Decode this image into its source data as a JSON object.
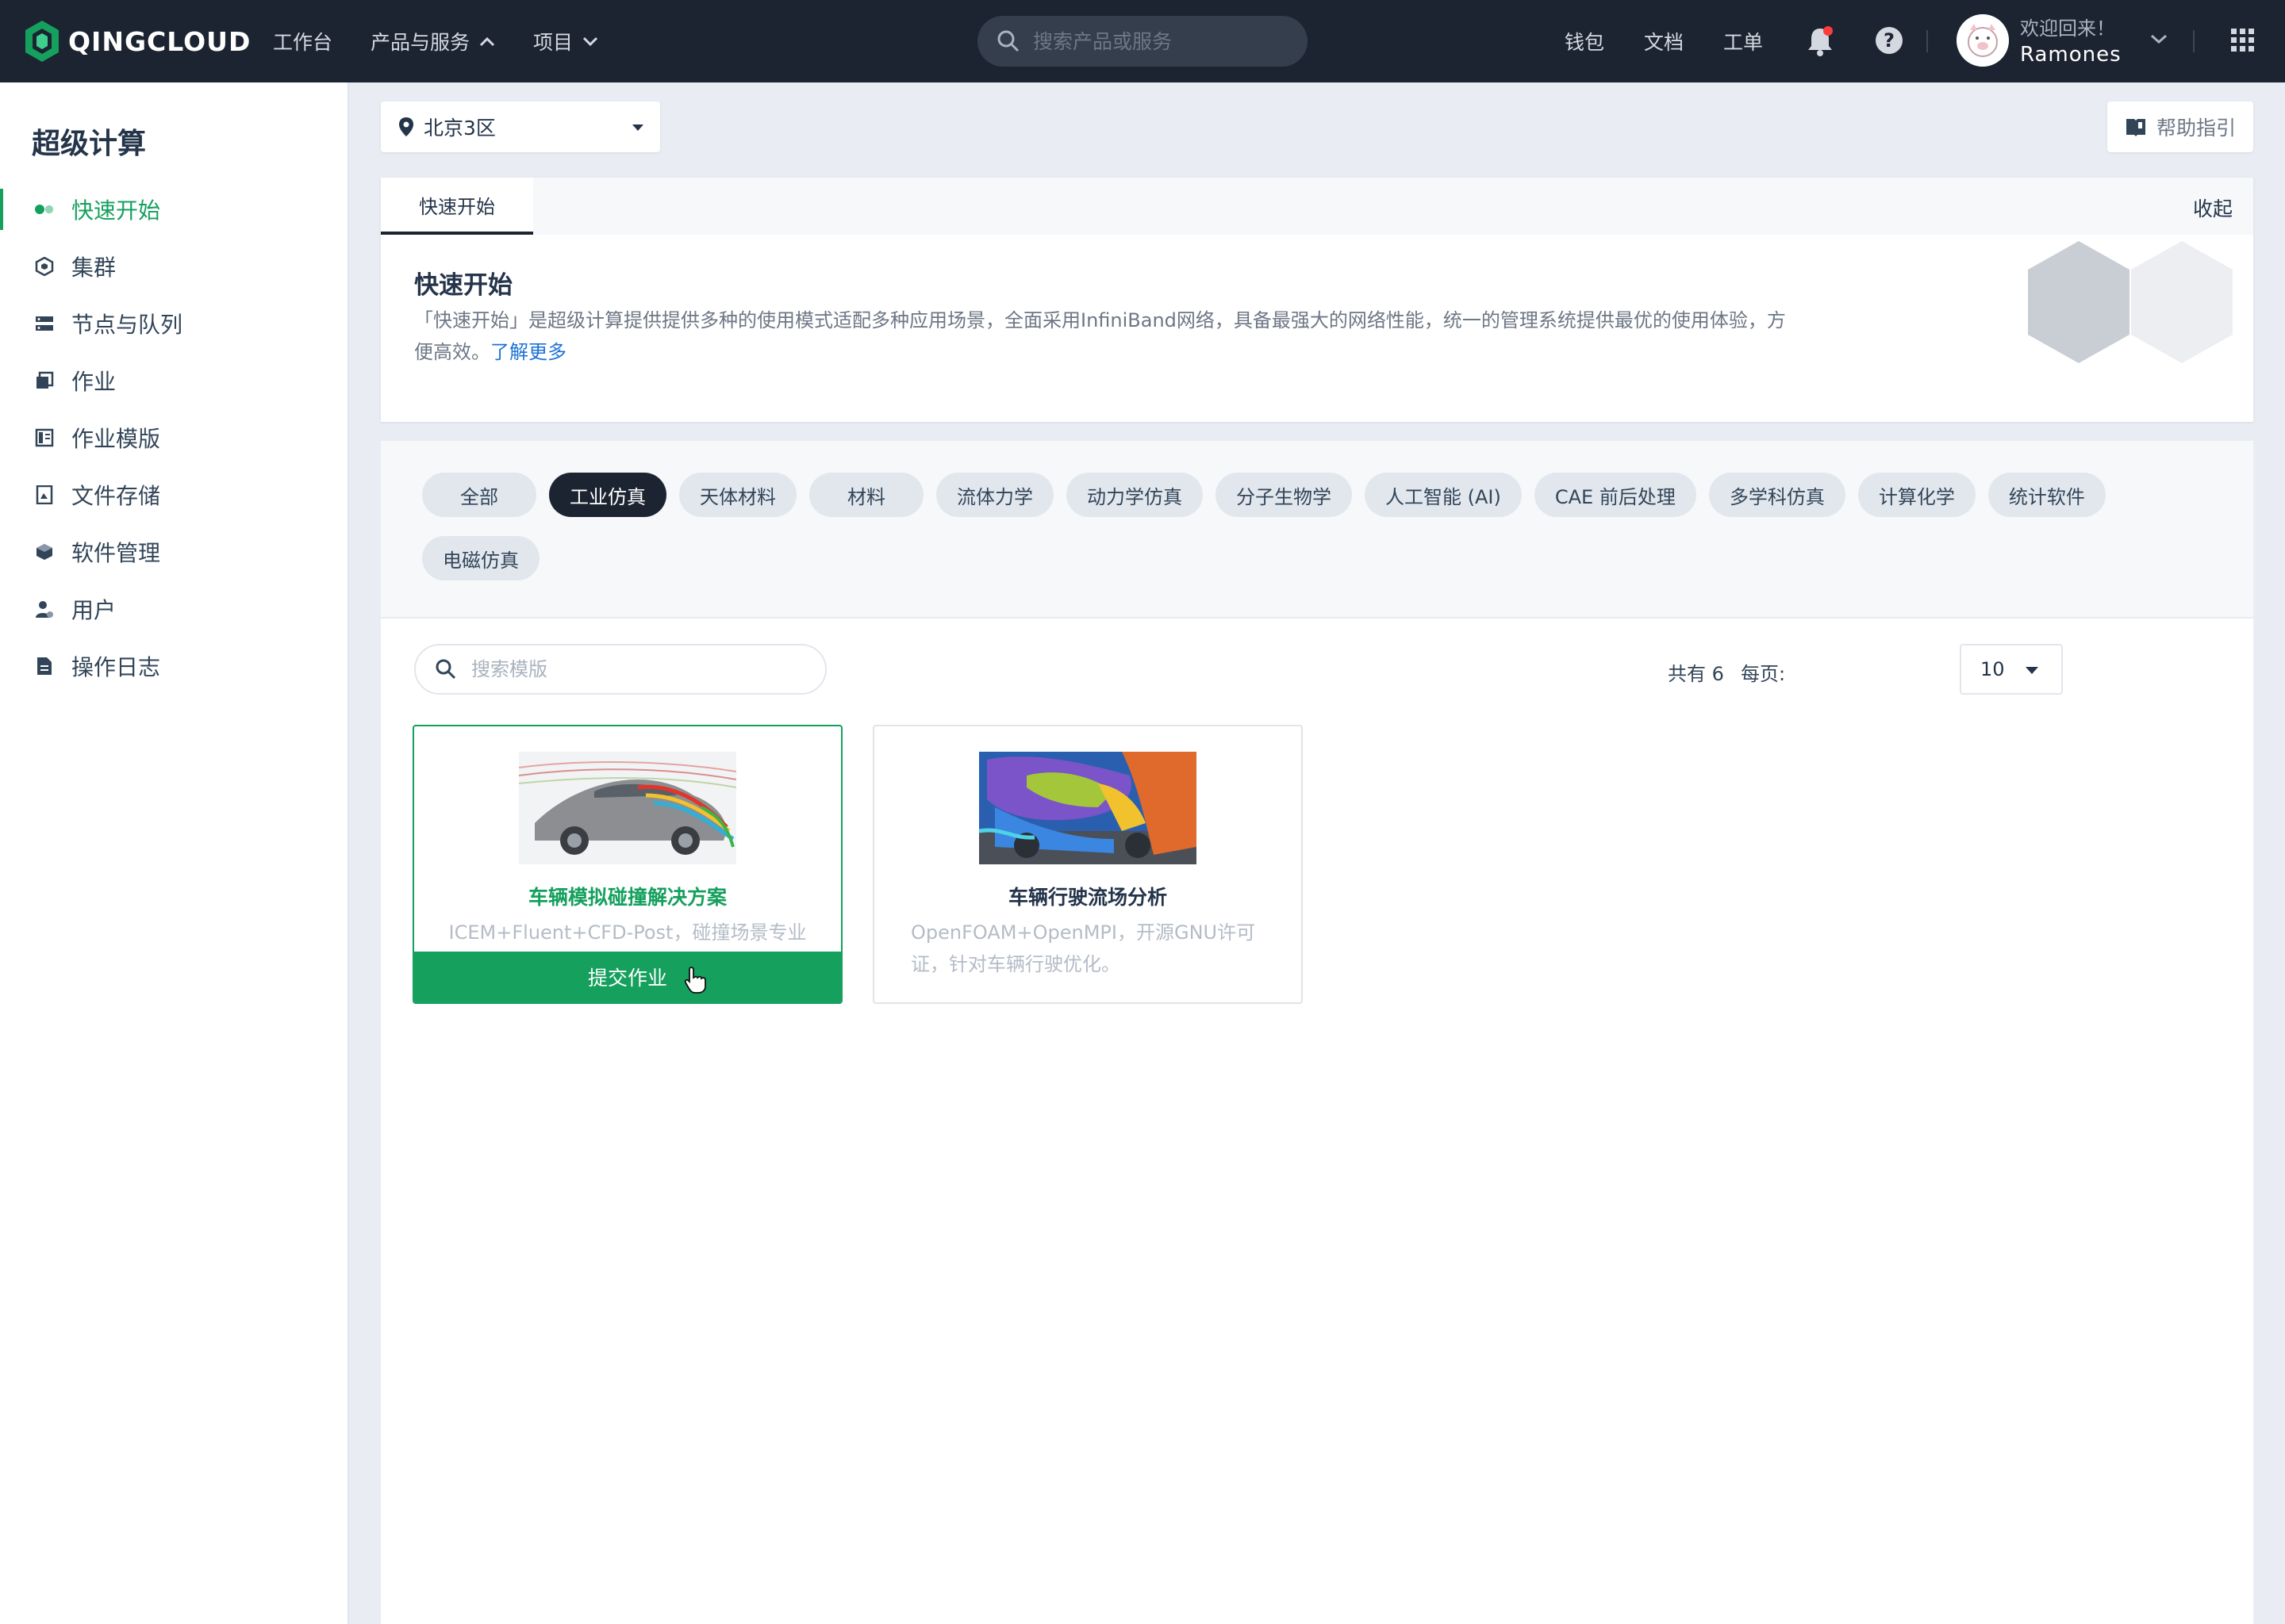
{
  "topbar": {
    "brand": "QINGCLOUD",
    "nav": [
      {
        "label": "工作台"
      },
      {
        "label": "产品与服务",
        "chevron": "chevron-up-icon"
      },
      {
        "label": "项目",
        "chevron": "chevron-down-icon"
      }
    ],
    "search_placeholder": "搜索产品或服务",
    "links": [
      "钱包",
      "文档",
      "工单"
    ],
    "welcome": "欢迎回来！",
    "username": "Ramones",
    "notification_dot_color": "#ff3b3b"
  },
  "sidebar": {
    "title": "超级计算",
    "items": [
      {
        "label": "快速开始",
        "icon": "quick-start-icon",
        "active": true
      },
      {
        "label": "集群",
        "icon": "cluster-icon"
      },
      {
        "label": "节点与队列",
        "icon": "nodes-queue-icon"
      },
      {
        "label": "作业",
        "icon": "job-icon"
      },
      {
        "label": "作业模版",
        "icon": "job-template-icon"
      },
      {
        "label": "文件存储",
        "icon": "file-storage-icon"
      },
      {
        "label": "软件管理",
        "icon": "software-icon"
      },
      {
        "label": "用户",
        "icon": "user-icon"
      },
      {
        "label": "操作日志",
        "icon": "log-icon"
      }
    ]
  },
  "region": {
    "selected": "北京3区"
  },
  "help": {
    "label": "帮助指引"
  },
  "intro": {
    "tab": "快速开始",
    "collapse": "收起",
    "title": "快速开始",
    "desc": "「快速开始」是超级计算提供提供多种的使用模式适配多种应用场景，全面采用InfiniBand网络，具备最强大的网络性能，统一的管理系统提供最优的使用体验，方便高效。",
    "learn_more": "了解更多"
  },
  "filters": {
    "selected_index": 1,
    "chips": [
      "全部",
      "工业仿真",
      "天体材料",
      "材料",
      "流体力学",
      "动力学仿真",
      "分子生物学",
      "人工智能 (AI)",
      "CAE 前后处理",
      "多学科仿真",
      "计算化学",
      "统计软件",
      "电磁仿真"
    ]
  },
  "templates": {
    "search_placeholder": "搜索模版",
    "total": "共有 6",
    "per_page_label": "每页:",
    "per_page": "10",
    "items": [
      {
        "name": "车辆模拟碰撞解决方案",
        "desc": "ICEM+Fluent+CFD-Post，碰撞场景专业",
        "selected": true,
        "submit": "提交作业"
      },
      {
        "name": "车辆行驶流场分析",
        "desc": "OpenFOAM+OpenMPI，开源GNU许可证，针对车辆行驶优化。",
        "selected": false
      }
    ]
  },
  "colors": {
    "accent": "#15a05e",
    "topbar_bg": "#1c2431",
    "link": "#1d72d6"
  }
}
